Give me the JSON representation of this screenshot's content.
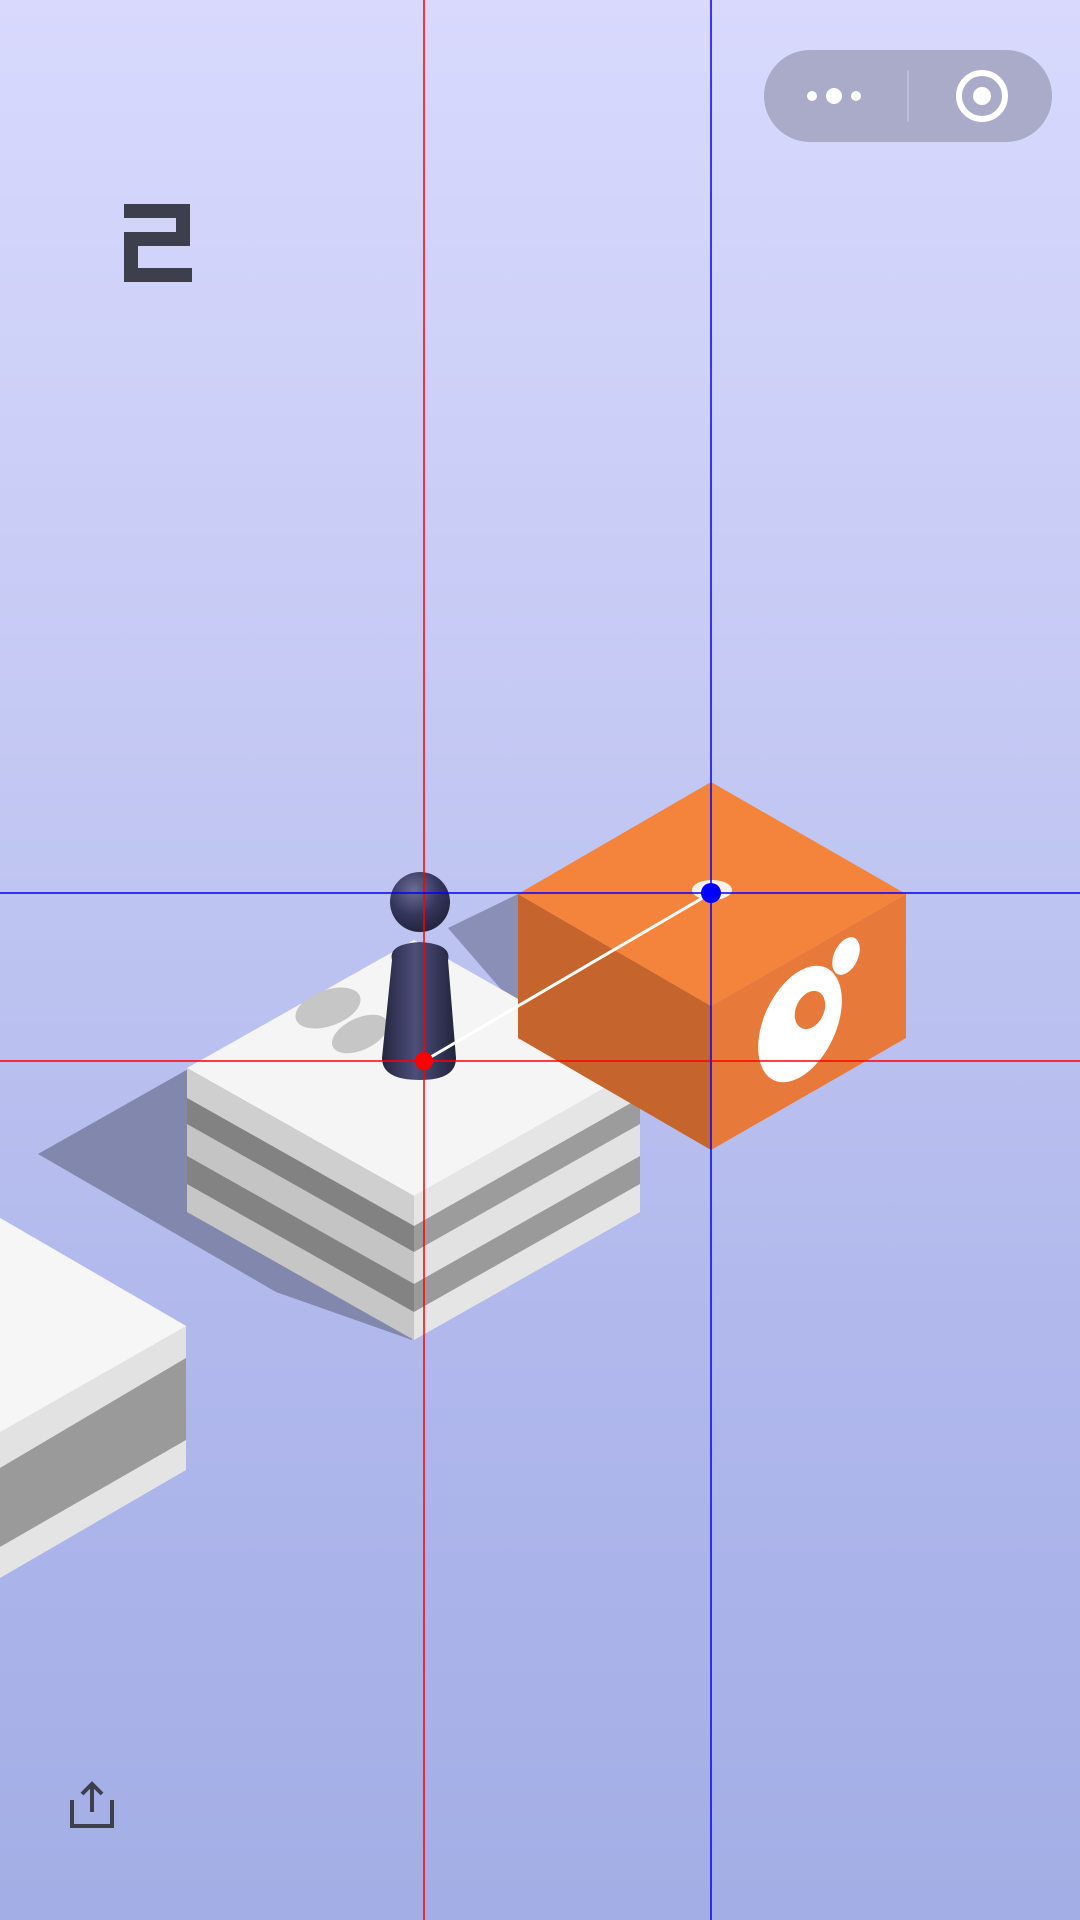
{
  "score": "2",
  "capsule": {
    "more_icon": "more-dots-icon",
    "close_icon": "target-circle-icon"
  },
  "share": {
    "icon": "share-upload-icon"
  },
  "colors": {
    "background_top": "#d8d9fd",
    "background_bottom": "#a3aee6",
    "player": "#2e2f52",
    "target_block": "#f4843b",
    "current_block": "#f6f6f6",
    "score_digits": "#3d3f4c",
    "guide_red": "#ff0000",
    "guide_blue": "#0000ff"
  },
  "objects": {
    "player": "chess-piece-player",
    "current_block": "striped-white-cube",
    "target_block": "orange-cube",
    "previous_block": "white-gray-cube"
  }
}
